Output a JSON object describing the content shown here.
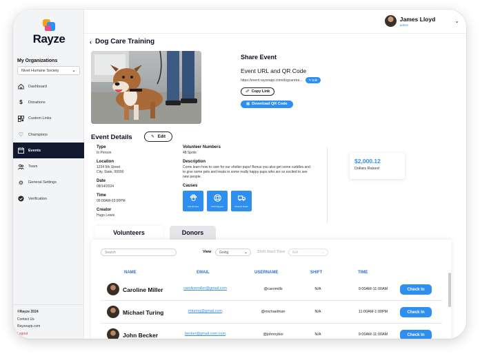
{
  "brand": {
    "name": "Rayze"
  },
  "sidebar": {
    "org_label": "My Organizations",
    "org_value": "Nivet Humane Society",
    "items": [
      {
        "label": "Dashboard",
        "icon": "home-icon"
      },
      {
        "label": "Donations",
        "icon": "dollar-icon"
      },
      {
        "label": "Custom Links",
        "icon": "qr-icon"
      },
      {
        "label": "Champions",
        "icon": "heart-icon"
      },
      {
        "label": "Events",
        "icon": "calendar-icon",
        "active": true
      },
      {
        "label": "Team",
        "icon": "team-icon"
      },
      {
        "label": "General Settings",
        "icon": "gear-icon"
      },
      {
        "label": "Verification",
        "icon": "verified-icon"
      }
    ],
    "footer": {
      "copyright": "©Rayze 2024",
      "contact": "Contact Us",
      "site": "Rayzeapp.com",
      "logout": "Logout"
    }
  },
  "user": {
    "name": "James Lloyd",
    "role": "admin"
  },
  "page": {
    "title": "Dog Care Training"
  },
  "share": {
    "title": "Share Event",
    "subtitle": "Event URL and QR Code",
    "url": "https://event.rayzeapp.com/dogcaretra...",
    "edit_label": "Edit",
    "copy_label": "Copy Link",
    "qr_label": "Download QR Code"
  },
  "details": {
    "title": "Event Details",
    "edit_label": "Edit",
    "type_label": "Type",
    "type": "In Person",
    "location_label": "Location",
    "location_line1": "1234 5th Street",
    "location_line2": "City, State, 00000",
    "date_label": "Date",
    "date": "08/14/2024",
    "time_label": "Time",
    "time": "09:00AM-03:00PM",
    "creator_label": "Creator",
    "creator": "Hugo Lewis",
    "volunteers_label": "Volunteer Numbers",
    "volunteers": "48 Spots",
    "description_label": "Description",
    "description": "Come learn how to care for our shelter pups! Bonus you also get some cuddles and to give some pets and treats to some really happy pups who are so excited to see new people.",
    "causes_label": "Causes",
    "causes": [
      {
        "label": "Animal Care",
        "icon": "paw-icon"
      },
      {
        "label": "Child Support",
        "icon": "lifebuoy-icon"
      },
      {
        "label": "Disaster Relief",
        "icon": "truck-icon"
      }
    ]
  },
  "raised": {
    "amount": "$2,000.12",
    "label": "Dollars Raised"
  },
  "tabs": {
    "volunteers": "Volunteers",
    "donors": "Donors"
  },
  "filters": {
    "search_placeholder": "Search",
    "view_label": "View",
    "view_value": "Going",
    "shift_label": "Shift Start Time",
    "shift_value": "N/A"
  },
  "table": {
    "headers": {
      "name": "NAME",
      "email": "EMAIL",
      "username": "USERNAME",
      "shift": "SHIFT",
      "time": "TIME"
    },
    "check_in_label": "Check In",
    "rows": [
      {
        "name": "Caroline Miller",
        "email": "carolinemiller@gmail.com",
        "username": "@caromills",
        "shift": "N/A",
        "time": "9:00AM-11:00AM"
      },
      {
        "name": "Michael Turing",
        "email": "mturing@gmail.com",
        "username": "@michaelman",
        "shift": "N/A",
        "time": "11:00AM-1:00PM"
      },
      {
        "name": "John Becker",
        "email": "becker@gmail.com.com",
        "username": "@johnnyboi",
        "shift": "N/A",
        "time": "9:00AM-11:00AM"
      }
    ]
  },
  "colors": {
    "accent": "#2f8ff0",
    "nav_active": "#111830",
    "brand_dark": "#0e0e24"
  }
}
